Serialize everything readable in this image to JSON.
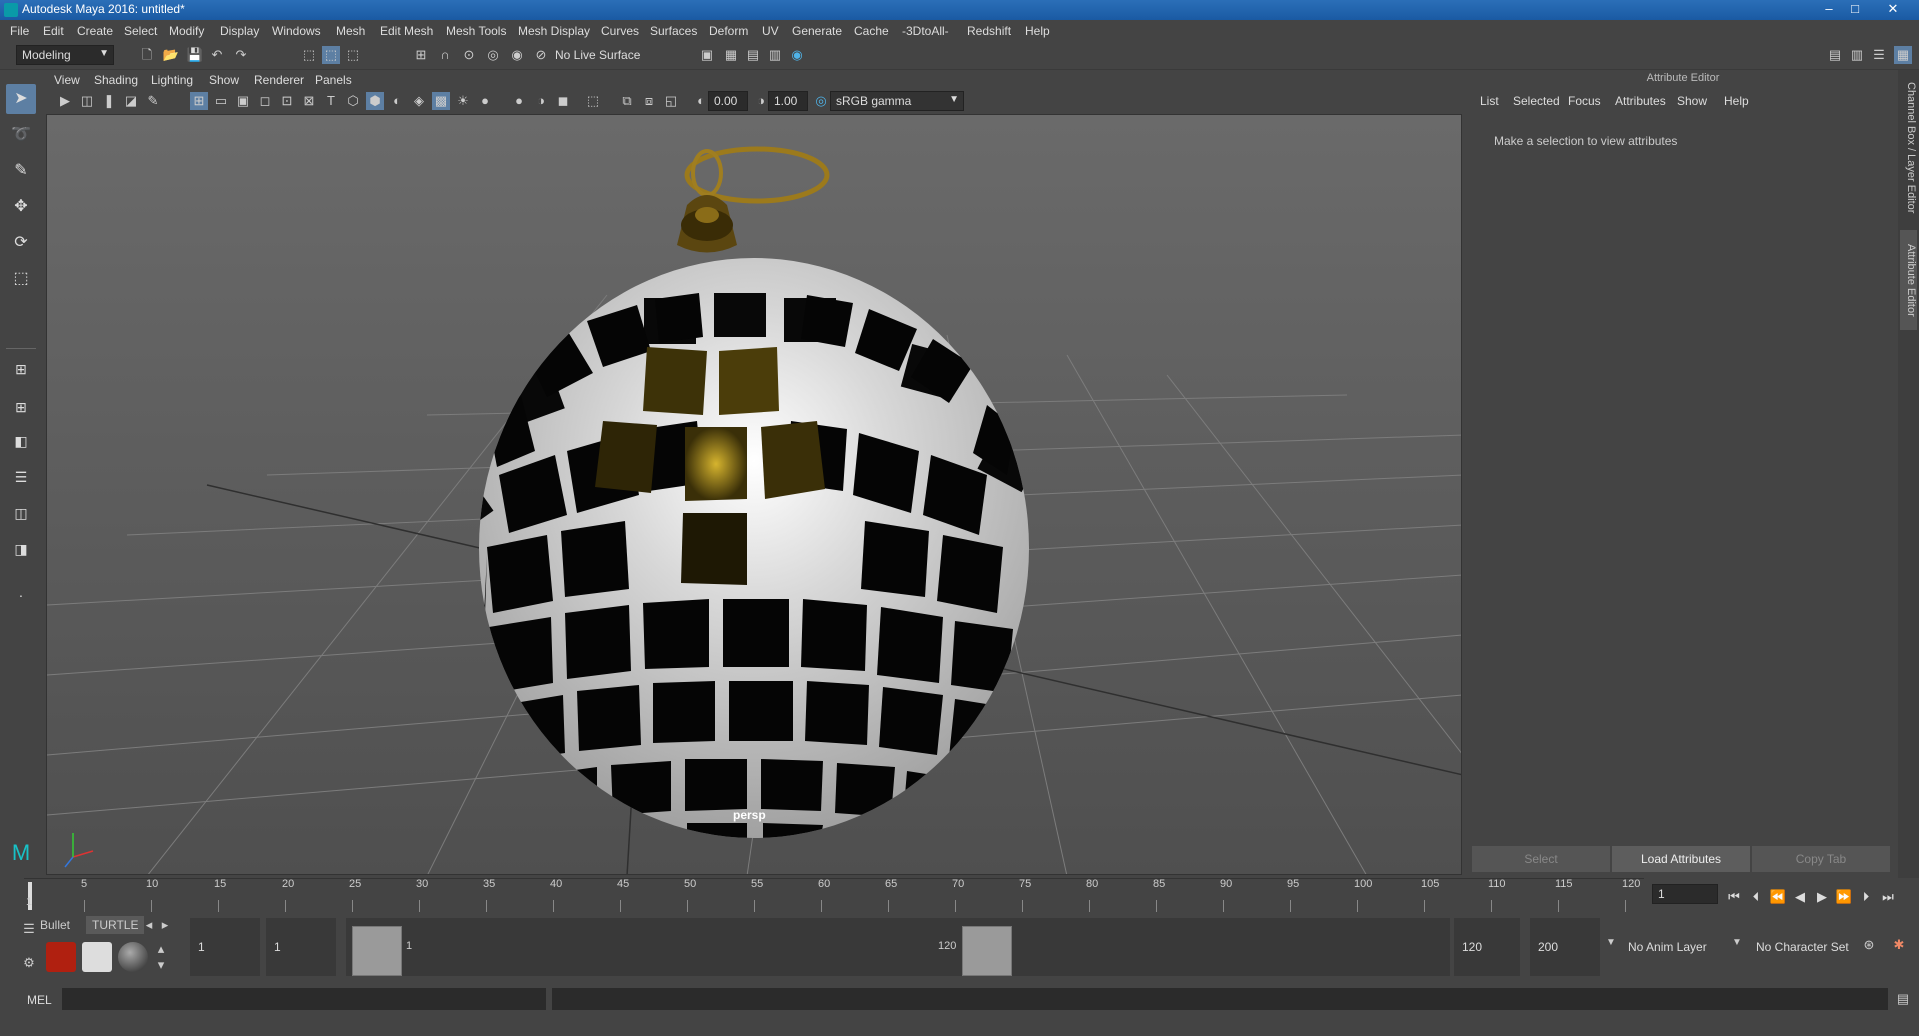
{
  "window": {
    "title": "Autodesk Maya 2016: untitled*",
    "minimize": "–",
    "maximize": "□",
    "close": "✕"
  },
  "menubar": [
    "File",
    "Edit",
    "Create",
    "Select",
    "Modify",
    "Display",
    "Windows",
    "Mesh",
    "Edit Mesh",
    "Mesh Tools",
    "Mesh Display",
    "Curves",
    "Surfaces",
    "Deform",
    "UV",
    "Generate",
    "Cache",
    "-3DtoAll-",
    "Redshift",
    "Help"
  ],
  "status": {
    "menuset": "Modeling",
    "live_surface": "No Live Surface"
  },
  "viewport": {
    "menu": [
      "View",
      "Shading",
      "Lighting",
      "Show",
      "Renderer",
      "Panels"
    ],
    "exposure": "0.00",
    "gamma": "1.00",
    "color_space": "sRGB gamma",
    "camera": "persp"
  },
  "attribute_editor": {
    "title": "Attribute Editor",
    "tabs": [
      "List",
      "Selected",
      "Focus",
      "Attributes",
      "Show",
      "Help"
    ],
    "message": "Make a selection to view attributes",
    "buttons": {
      "select": "Select",
      "load": "Load Attributes",
      "copy": "Copy Tab"
    },
    "side_tabs": [
      "Channel Box / Layer Editor",
      "Attribute Editor"
    ]
  },
  "timeline": {
    "ticks": [
      "5",
      "10",
      "15",
      "20",
      "25",
      "30",
      "35",
      "40",
      "45",
      "50",
      "55",
      "60",
      "65",
      "70",
      "75",
      "80",
      "85",
      "90",
      "95",
      "100",
      "105",
      "110",
      "115",
      "120"
    ],
    "start_label": "1",
    "current_frame": "1"
  },
  "range": {
    "shelf_tabs": [
      "Bullet",
      "TURTLE"
    ],
    "start_time": "1",
    "playback_start": "1",
    "range_min_label": "1",
    "range_max_label": "120",
    "playback_end": "120",
    "end_time": "200",
    "anim_layer": "No Anim Layer",
    "char_set": "No Character Set"
  },
  "command": {
    "language": "MEL"
  },
  "colors": {
    "accent": "#5d7fa3",
    "titlebar": "#1a5aa3",
    "gold": "#c9a227",
    "viewport_bg": "#5c5c5c"
  },
  "icons": {
    "select": "arrow-select-icon",
    "lasso": "lasso-icon",
    "paint": "paint-select-icon",
    "move": "move-icon",
    "rotate": "rotate-icon",
    "scale": "scale-icon"
  }
}
